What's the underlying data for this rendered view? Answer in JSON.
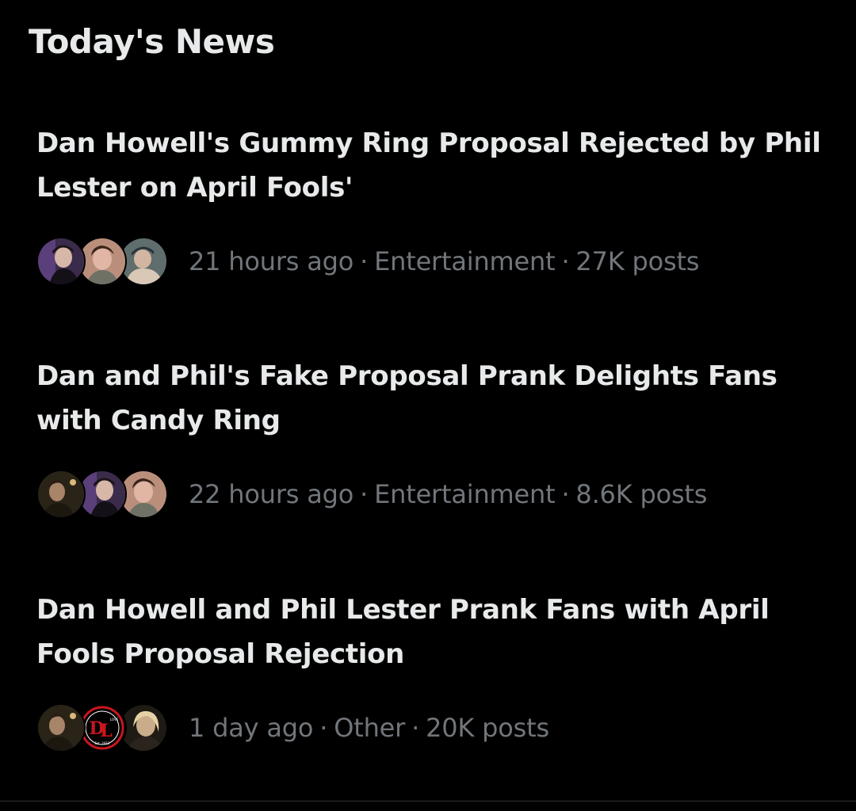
{
  "section": {
    "title": "Today's News"
  },
  "news": [
    {
      "headline": "Dan Howell's Gummy Ring Proposal Rejected by Phil Lester on April Fools'",
      "time": "21 hours ago",
      "category": "Entertainment",
      "posts": "27K posts"
    },
    {
      "headline": "Dan and Phil's Fake Proposal Prank Delights Fans with Candy Ring",
      "time": "22 hours ago",
      "category": "Entertainment",
      "posts": "8.6K posts"
    },
    {
      "headline": "Dan Howell and Phil Lester Prank Fans with April Fools Proposal Rejection",
      "time": "1 day ago",
      "category": "Other",
      "posts": "20K posts"
    }
  ],
  "separator": "·",
  "colors": {
    "background": "#000000",
    "primary_text": "#e7e9ea",
    "secondary_text": "#71767b",
    "logo_red": "#c8161d"
  },
  "avatar_logo": {
    "letters": "DL",
    "small_text_1": "LOVE",
    "small_text_2": "Est. 2013"
  }
}
